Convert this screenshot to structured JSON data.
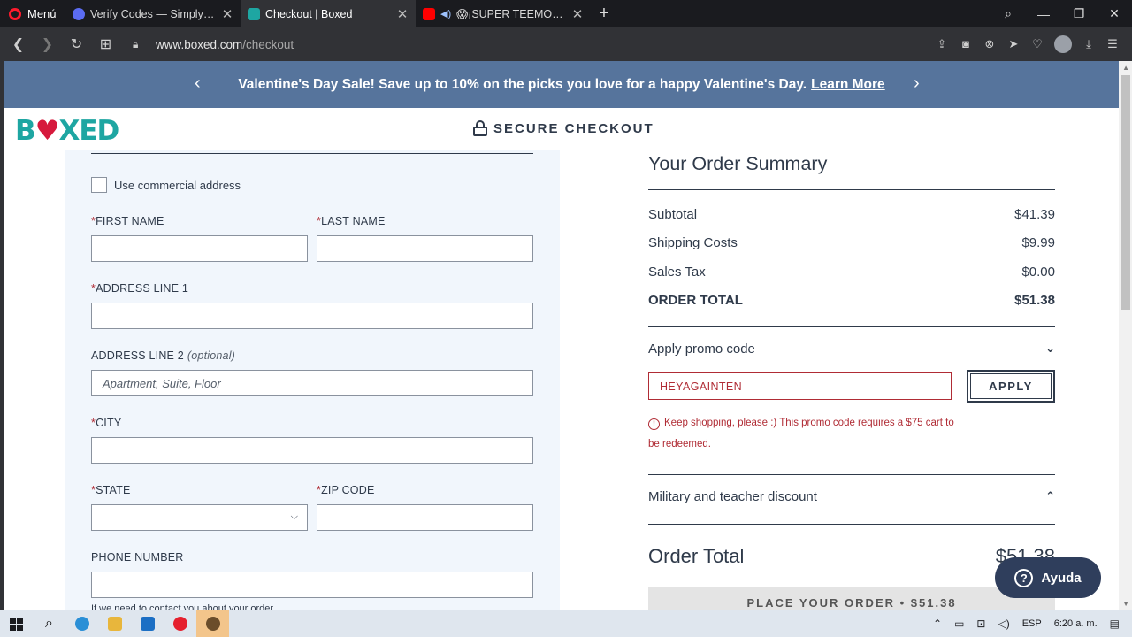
{
  "browser": {
    "menu_label": "Menú",
    "tabs": [
      {
        "title": "Verify Codes — SimplyCodes",
        "favicon_color": "#5b6cf2",
        "close": "✕"
      },
      {
        "title": "Checkout | Boxed",
        "favicon_color": "#1ea6a2",
        "close": "✕"
      },
      {
        "title": "😱¡SUPER TEEMO *DEATH",
        "favicon_color": "#ff0000",
        "close": "✕"
      }
    ],
    "new_tab": "+",
    "url_host": "www.boxed.com",
    "url_path": "/checkout"
  },
  "banner": {
    "text": "Valentine's Day Sale! Save up to 10% on the picks you love for a happy Valentine's Day.",
    "link": "Learn More",
    "prev": "‹",
    "next": "›"
  },
  "header": {
    "logo_b": "B",
    "logo_heart": "♥",
    "logo_rest": "XED",
    "secure": "SECURE CHECKOUT"
  },
  "form": {
    "commercial_label": "Use commercial address",
    "first_name_label": "FIRST NAME",
    "last_name_label": "LAST NAME",
    "address1_label": "ADDRESS LINE 1",
    "address2_label": "ADDRESS LINE 2",
    "address2_optional": "(optional)",
    "address2_placeholder": "Apartment, Suite, Floor",
    "city_label": "CITY",
    "state_label": "STATE",
    "zip_label": "ZIP CODE",
    "phone_label": "PHONE NUMBER",
    "required_mark": "*",
    "cut_text": "If we need to contact you about your order"
  },
  "summary": {
    "title": "Your Order Summary",
    "rows": [
      {
        "label": "Subtotal",
        "value": "$41.39"
      },
      {
        "label": "Shipping Costs",
        "value": "$9.99"
      },
      {
        "label": "Sales Tax",
        "value": "$0.00"
      },
      {
        "label": "ORDER TOTAL",
        "value": "$51.38"
      }
    ],
    "promo_label": "Apply promo code",
    "promo_value": "HEYAGAINTEN",
    "apply": "APPLY",
    "error_icon": "!",
    "error": "Keep shopping, please :) This promo code requires a $75 cart to be redeemed.",
    "military": "Military and teacher discount",
    "order_total_label": "Order Total",
    "order_total_value": "$51.38",
    "place_order": "PLACE YOUR ORDER • $51.38"
  },
  "help": {
    "label": "Ayuda",
    "icon": "?"
  },
  "taskbar": {
    "lang": "ESP",
    "time": "6:20 a. m."
  },
  "colors": {
    "banner": "#56749c",
    "brand_teal": "#1ea6a2",
    "brand_red": "#d6193c",
    "error": "#b02c35",
    "navy": "#2f3a4a"
  }
}
